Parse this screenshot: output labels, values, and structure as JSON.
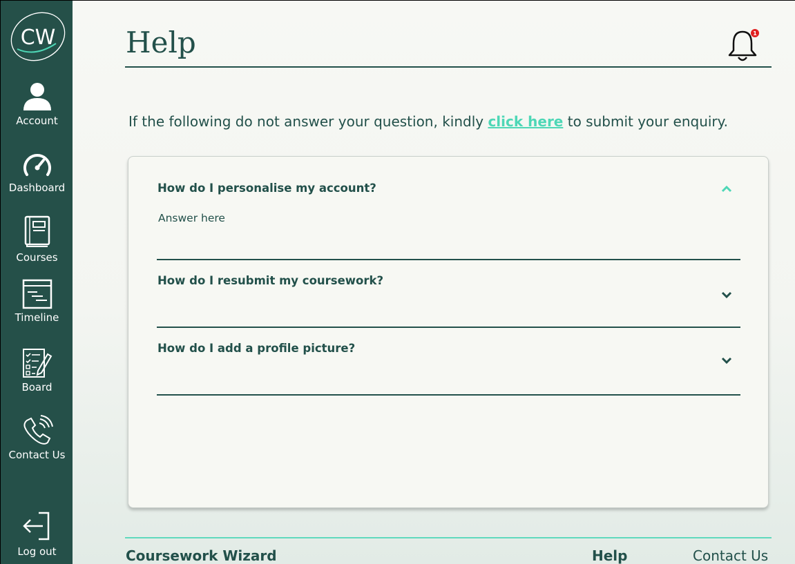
{
  "app": {
    "logo_text": "CW",
    "brand": "Coursework Wizard"
  },
  "sidebar": {
    "items": [
      {
        "label": "Account",
        "icon": "user-icon"
      },
      {
        "label": "Dashboard",
        "icon": "speedometer-icon"
      },
      {
        "label": "Courses",
        "icon": "book-icon"
      },
      {
        "label": "Timeline",
        "icon": "timeline-icon"
      },
      {
        "label": "Board",
        "icon": "checklist-icon"
      },
      {
        "label": "Contact Us",
        "icon": "phone-icon"
      }
    ],
    "logout": {
      "label": "Log out",
      "icon": "logout-icon"
    }
  },
  "header": {
    "title": "Help",
    "notifications": {
      "count": "1",
      "icon": "bell-icon",
      "badge_color": "#e02020"
    }
  },
  "intro": {
    "before": "If the following do not answer your question, kindly ",
    "link": "click here",
    "after": " to submit your enquiry."
  },
  "faq": [
    {
      "question": "How do I personalise my account?",
      "answer": "Answer here",
      "expanded": true
    },
    {
      "question": "How do I resubmit my coursework?",
      "expanded": false
    },
    {
      "question": "How do I add a profile picture?",
      "expanded": false
    }
  ],
  "footer": {
    "brand": "Coursework Wizard",
    "help": "Help",
    "contact": "Contact Us"
  },
  "colors": {
    "sidebar": "#255049",
    "text": "#22504a",
    "accent": "#4ed7b6"
  }
}
